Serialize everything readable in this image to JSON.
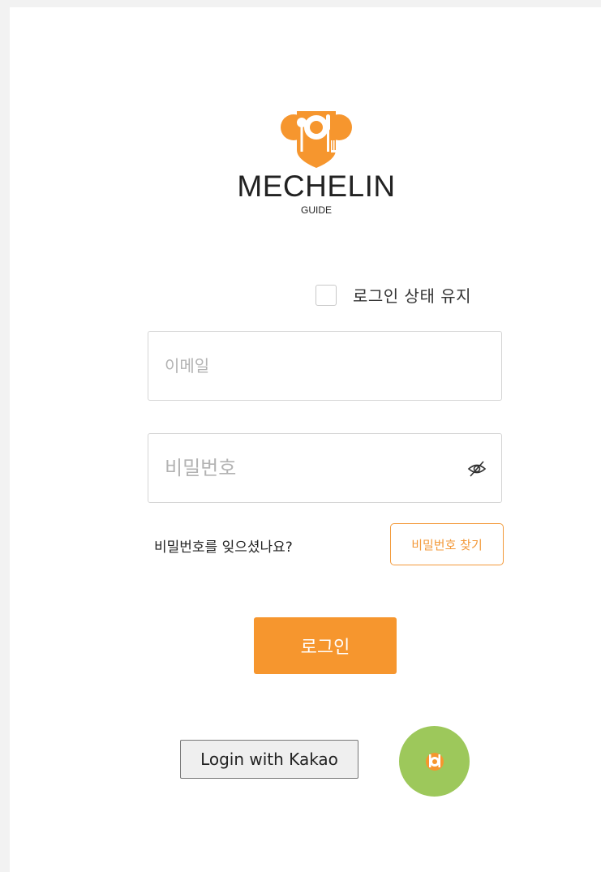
{
  "brand": {
    "name": "MECHELIN",
    "sub": "GUIDE",
    "logo_icon": "utensils-shield-icon",
    "accent_color": "#f6962e"
  },
  "login_form": {
    "keep_logged_in_label": "로그인 상태 유지",
    "keep_logged_in_checked": false,
    "email": {
      "placeholder": "이메일",
      "value": ""
    },
    "password": {
      "placeholder": "비밀번호",
      "value": "",
      "toggle_icon": "eye-off-icon"
    },
    "forgot_text": "비밀번호를 잊으셨나요?",
    "find_password_label": "비밀번호 찾기",
    "login_label": "로그인"
  },
  "social": {
    "kakao_label": "Login with Kakao",
    "chat_icon": "mechelin-chat-icon",
    "chat_color": "#9dc85b"
  }
}
